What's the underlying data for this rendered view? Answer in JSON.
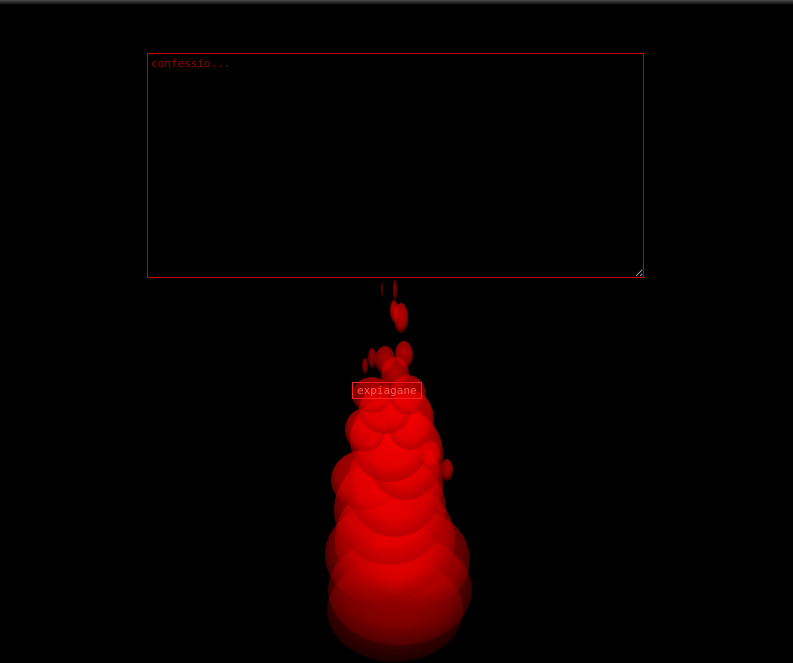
{
  "confession": {
    "value": "",
    "placeholder": "confessio..."
  },
  "actions": {
    "expiate_label": "expiagane"
  },
  "colors": {
    "background": "#000000",
    "accent": "#ff0000",
    "border": "#c80000"
  },
  "icons": {
    "flame": "flame-icon",
    "resize_grip": "resize-grip-icon"
  }
}
